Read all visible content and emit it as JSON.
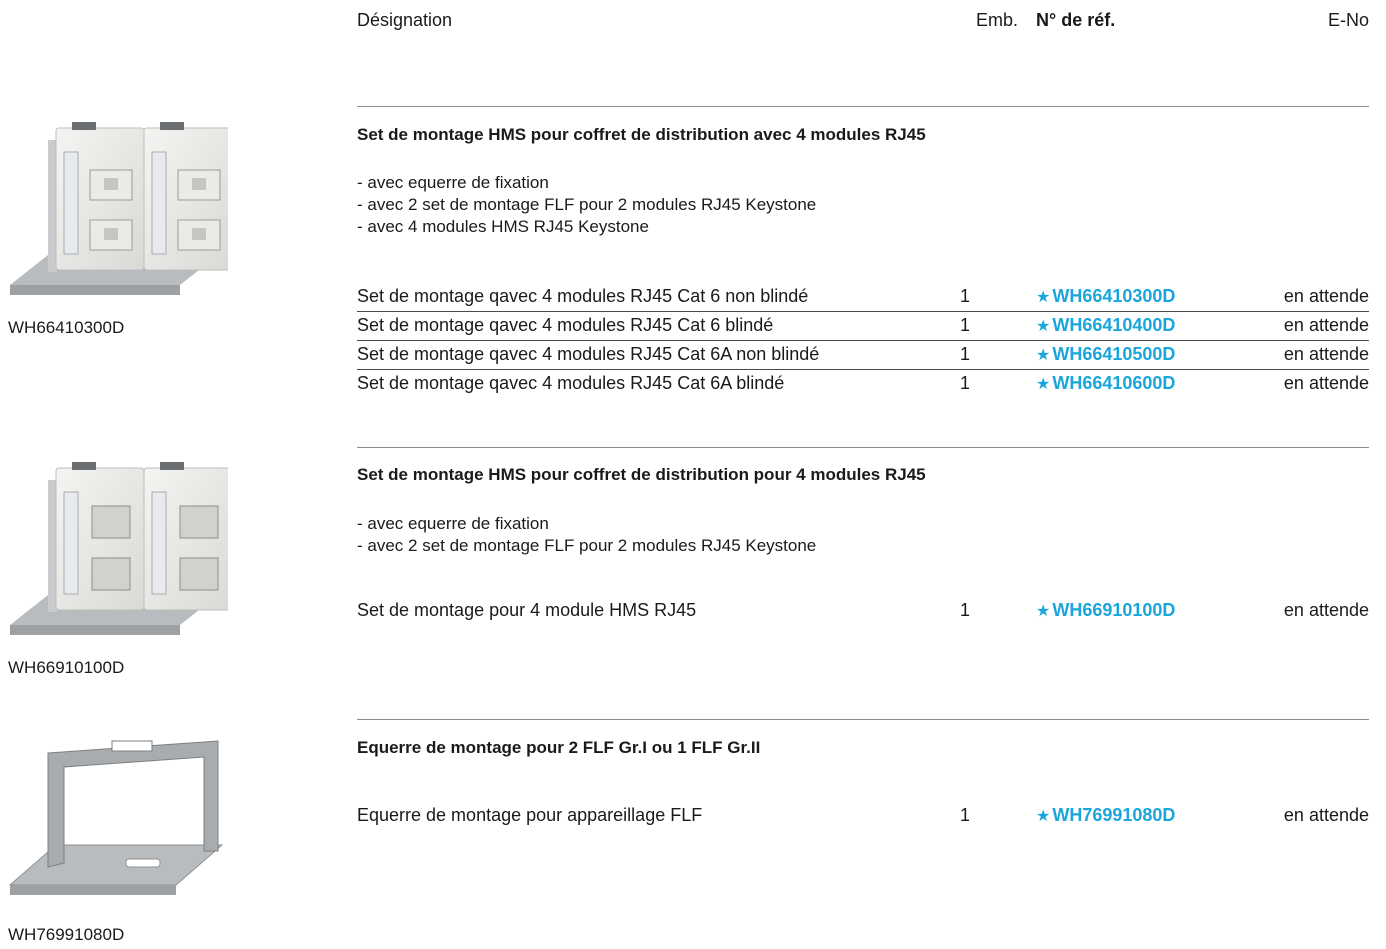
{
  "header": {
    "designation": "Désignation",
    "emb": "Emb.",
    "ref": "N° de réf.",
    "eno": "E-No"
  },
  "colors": {
    "ref_accent": "#1aa6dd",
    "rule": "#8c8c8c"
  },
  "ref_icon": "star-icon",
  "sections": [
    {
      "image_caption": "WH66410300D",
      "title": "Set de montage HMS pour coffret de distribution avec 4 modules RJ45",
      "bullets": [
        "- avec equerre de fixation",
        "- avec 2 set de montage FLF pour 2 modules RJ45 Keystone",
        "- avec 4 modules HMS RJ45 Keystone"
      ],
      "rows": [
        {
          "desc": "Set de montage qavec 4 modules RJ45 Cat 6 non blindé",
          "emb": "1",
          "star": "★",
          "ref": "WH66410300D",
          "eno": "en attende"
        },
        {
          "desc": "Set de montage qavec 4 modules RJ45 Cat 6 blindé",
          "emb": "1",
          "star": "★",
          "ref": "WH66410400D",
          "eno": "en attende"
        },
        {
          "desc": "Set de montage qavec 4 modules RJ45 Cat 6A non blindé",
          "emb": "1",
          "star": "★",
          "ref": "WH66410500D",
          "eno": "en attende"
        },
        {
          "desc": "Set de montage qavec 4 modules RJ45 Cat 6A blindé",
          "emb": "1",
          "star": "★",
          "ref": "WH66410600D",
          "eno": "en attende"
        }
      ]
    },
    {
      "image_caption": "WH66910100D",
      "title": "Set de montage HMS pour coffret de distribution pour 4 modules RJ45",
      "bullets": [
        " - avec equerre de fixation",
        " - avec 2 set de montage FLF pour 2 modules RJ45 Keystone"
      ],
      "rows": [
        {
          "desc": "Set de montage pour 4 module HMS RJ45",
          "emb": "1",
          "star": "★",
          "ref": "WH66910100D",
          "eno": "en attende"
        }
      ]
    },
    {
      "image_caption": "WH76991080D",
      "title": "Equerre de montage pour 2 FLF Gr.I ou 1 FLF Gr.II",
      "bullets": [],
      "rows": [
        {
          "desc": "Equerre de montage pour appareillage FLF",
          "emb": "1",
          "star": "★",
          "ref": "WH76991080D",
          "eno": "en attende"
        }
      ]
    }
  ]
}
